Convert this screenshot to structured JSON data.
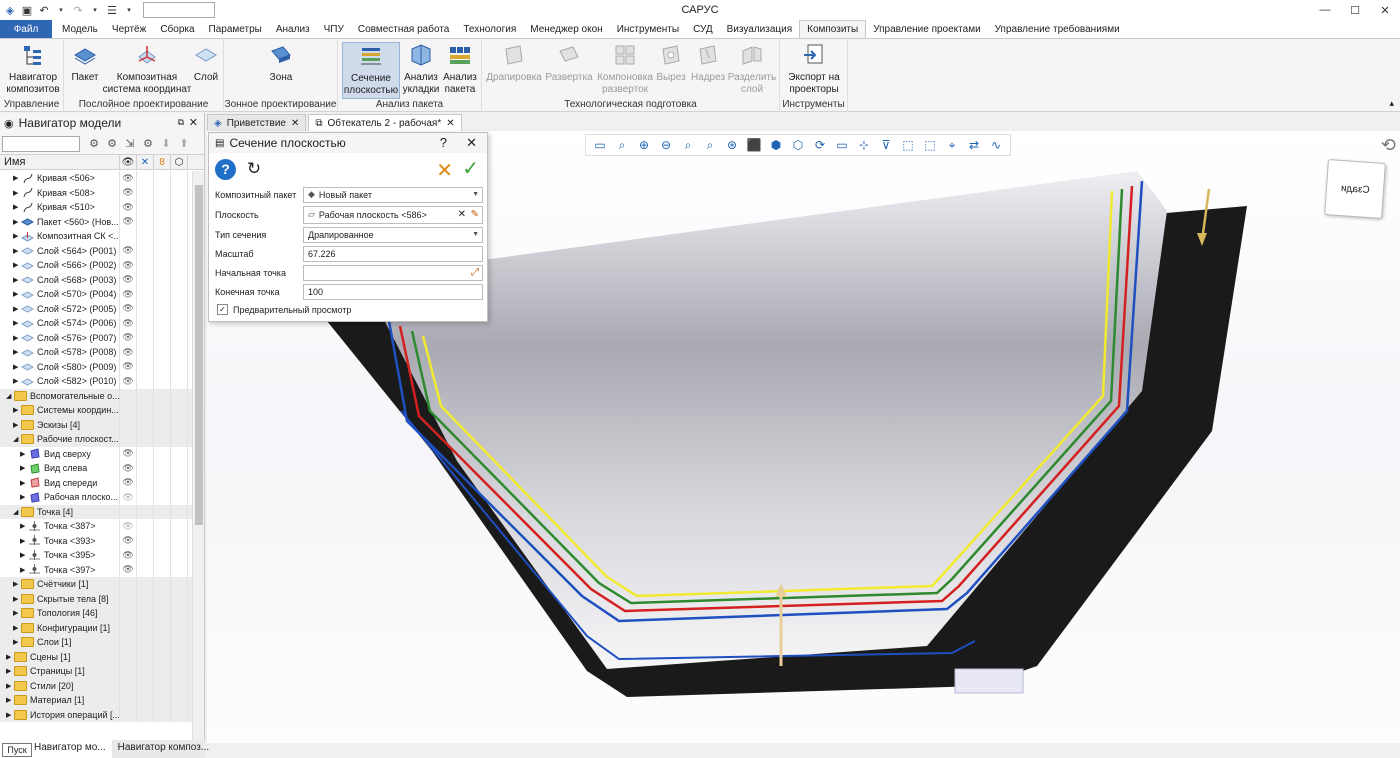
{
  "window": {
    "title": "САРУС"
  },
  "ribbon_tabs": [
    "Файл",
    "Модель",
    "Чертёж",
    "Сборка",
    "Параметры",
    "Анализ",
    "ЧПУ",
    "Совместная работа",
    "Технология",
    "Менеджер окон",
    "Инструменты",
    "СУД",
    "Визуализация",
    "Композиты",
    "Управление проектами",
    "Управление требованиями"
  ],
  "ribbon": {
    "g1": {
      "label": "Управление",
      "b1": "Навигатор композитов"
    },
    "g2": {
      "label": "Послойное проектирование",
      "b1": "Пакет",
      "b2": "Композитная система координат",
      "b3": "Слой"
    },
    "g3": {
      "label": "Зонное проектирование",
      "b1": "Зона"
    },
    "g4": {
      "label": "Анализ пакета",
      "b1": "Сечение плоскостью",
      "b2": "Анализ укладки",
      "b3": "Анализ пакета"
    },
    "g5": {
      "label": "Технологическая подготовка",
      "b1": "Драпировка",
      "b2": "Развертка",
      "b3": "Компоновка разверток",
      "b4": "Вырез",
      "b5": "Надрез",
      "b6": "Разделить слой"
    },
    "g6": {
      "label": "Инструменты",
      "b1": "Экспорт на проекторы"
    }
  },
  "navigator": {
    "title": "Навигатор модели",
    "column_name": "Имя",
    "rows": [
      {
        "label": "Кривая <506>",
        "icon": "curve"
      },
      {
        "label": "Кривая <508>",
        "icon": "curve"
      },
      {
        "label": "Кривая <510>",
        "icon": "curve"
      },
      {
        "label": "Пакет <560> (Нов...",
        "icon": "pack"
      },
      {
        "label": "Композитная СК <...",
        "icon": "cs"
      },
      {
        "label": "Слой <564> (P001)",
        "icon": "ply"
      },
      {
        "label": "Слой <566> (P002)",
        "icon": "ply"
      },
      {
        "label": "Слой <568> (P003)",
        "icon": "ply"
      },
      {
        "label": "Слой <570> (P004)",
        "icon": "ply"
      },
      {
        "label": "Слой <572> (P005)",
        "icon": "ply"
      },
      {
        "label": "Слой <574> (P006)",
        "icon": "ply"
      },
      {
        "label": "Слой <576> (P007)",
        "icon": "ply"
      },
      {
        "label": "Слой <578> (P008)",
        "icon": "ply"
      },
      {
        "label": "Слой <580> (P009)",
        "icon": "ply"
      },
      {
        "label": "Слой <582> (P010)",
        "icon": "ply"
      },
      {
        "label": "Вспомогательные о...",
        "icon": "folder"
      },
      {
        "label": "Системы координ...",
        "icon": "folder"
      },
      {
        "label": "Эскизы [4]",
        "icon": "folder"
      },
      {
        "label": "Рабочие плоскост...",
        "icon": "folder"
      },
      {
        "label": "Вид сверху",
        "icon": "plane-blue"
      },
      {
        "label": "Вид слева",
        "icon": "plane-green"
      },
      {
        "label": "Вид спереди",
        "icon": "plane-red"
      },
      {
        "label": "Рабочая плоско...",
        "icon": "plane-blue"
      },
      {
        "label": "Точка [4]",
        "icon": "folder"
      },
      {
        "label": "Точка <387>",
        "icon": "point"
      },
      {
        "label": "Точка <393>",
        "icon": "point"
      },
      {
        "label": "Точка <395>",
        "icon": "point"
      },
      {
        "label": "Точка <397>",
        "icon": "point"
      },
      {
        "label": "Счётчики [1]",
        "icon": "folder"
      },
      {
        "label": "Скрытые тела [8]",
        "icon": "folder"
      },
      {
        "label": "Топология [46]",
        "icon": "folder"
      },
      {
        "label": "Конфигурации [1]",
        "icon": "folder"
      },
      {
        "label": "Слои [1]",
        "icon": "folder"
      },
      {
        "label": "Сцены [1]",
        "icon": "folder"
      },
      {
        "label": "Страницы [1]",
        "icon": "folder"
      },
      {
        "label": "Стили [20]",
        "icon": "folder"
      },
      {
        "label": "Материал [1]",
        "icon": "folder"
      },
      {
        "label": "История операций [...",
        "icon": "folder"
      }
    ]
  },
  "bottom_tabs": [
    "Навигатор мо...",
    "Навигатор композ..."
  ],
  "start_button": "Пуск",
  "doc_tabs": [
    "Приветствие",
    "Обтекатель 2 - рабочая*"
  ],
  "view_cube": "Сзади",
  "dialog": {
    "title": "Сечение плоскостью",
    "help": "?",
    "fields": {
      "pack_label": "Композитный пакет",
      "pack_value": "Новый пакет",
      "plane_label": "Плоскость",
      "plane_value": "Рабочая плоскость <586>",
      "type_label": "Тип сечения",
      "type_value": "Драпированное",
      "scale_label": "Масштаб",
      "scale_value": "67.226",
      "start_label": "Начальная точка",
      "start_value": "",
      "end_label": "Конечная точка",
      "end_value": "100"
    },
    "preview_label": "Предварительный просмотр",
    "preview_checked": true
  },
  "colors": {
    "accent": "#2f67b4",
    "blue": "#1f4fc0",
    "red": "#d42020",
    "green": "#2f8a2f",
    "yellow": "#f2ea30",
    "body": "#1a1a1a"
  }
}
